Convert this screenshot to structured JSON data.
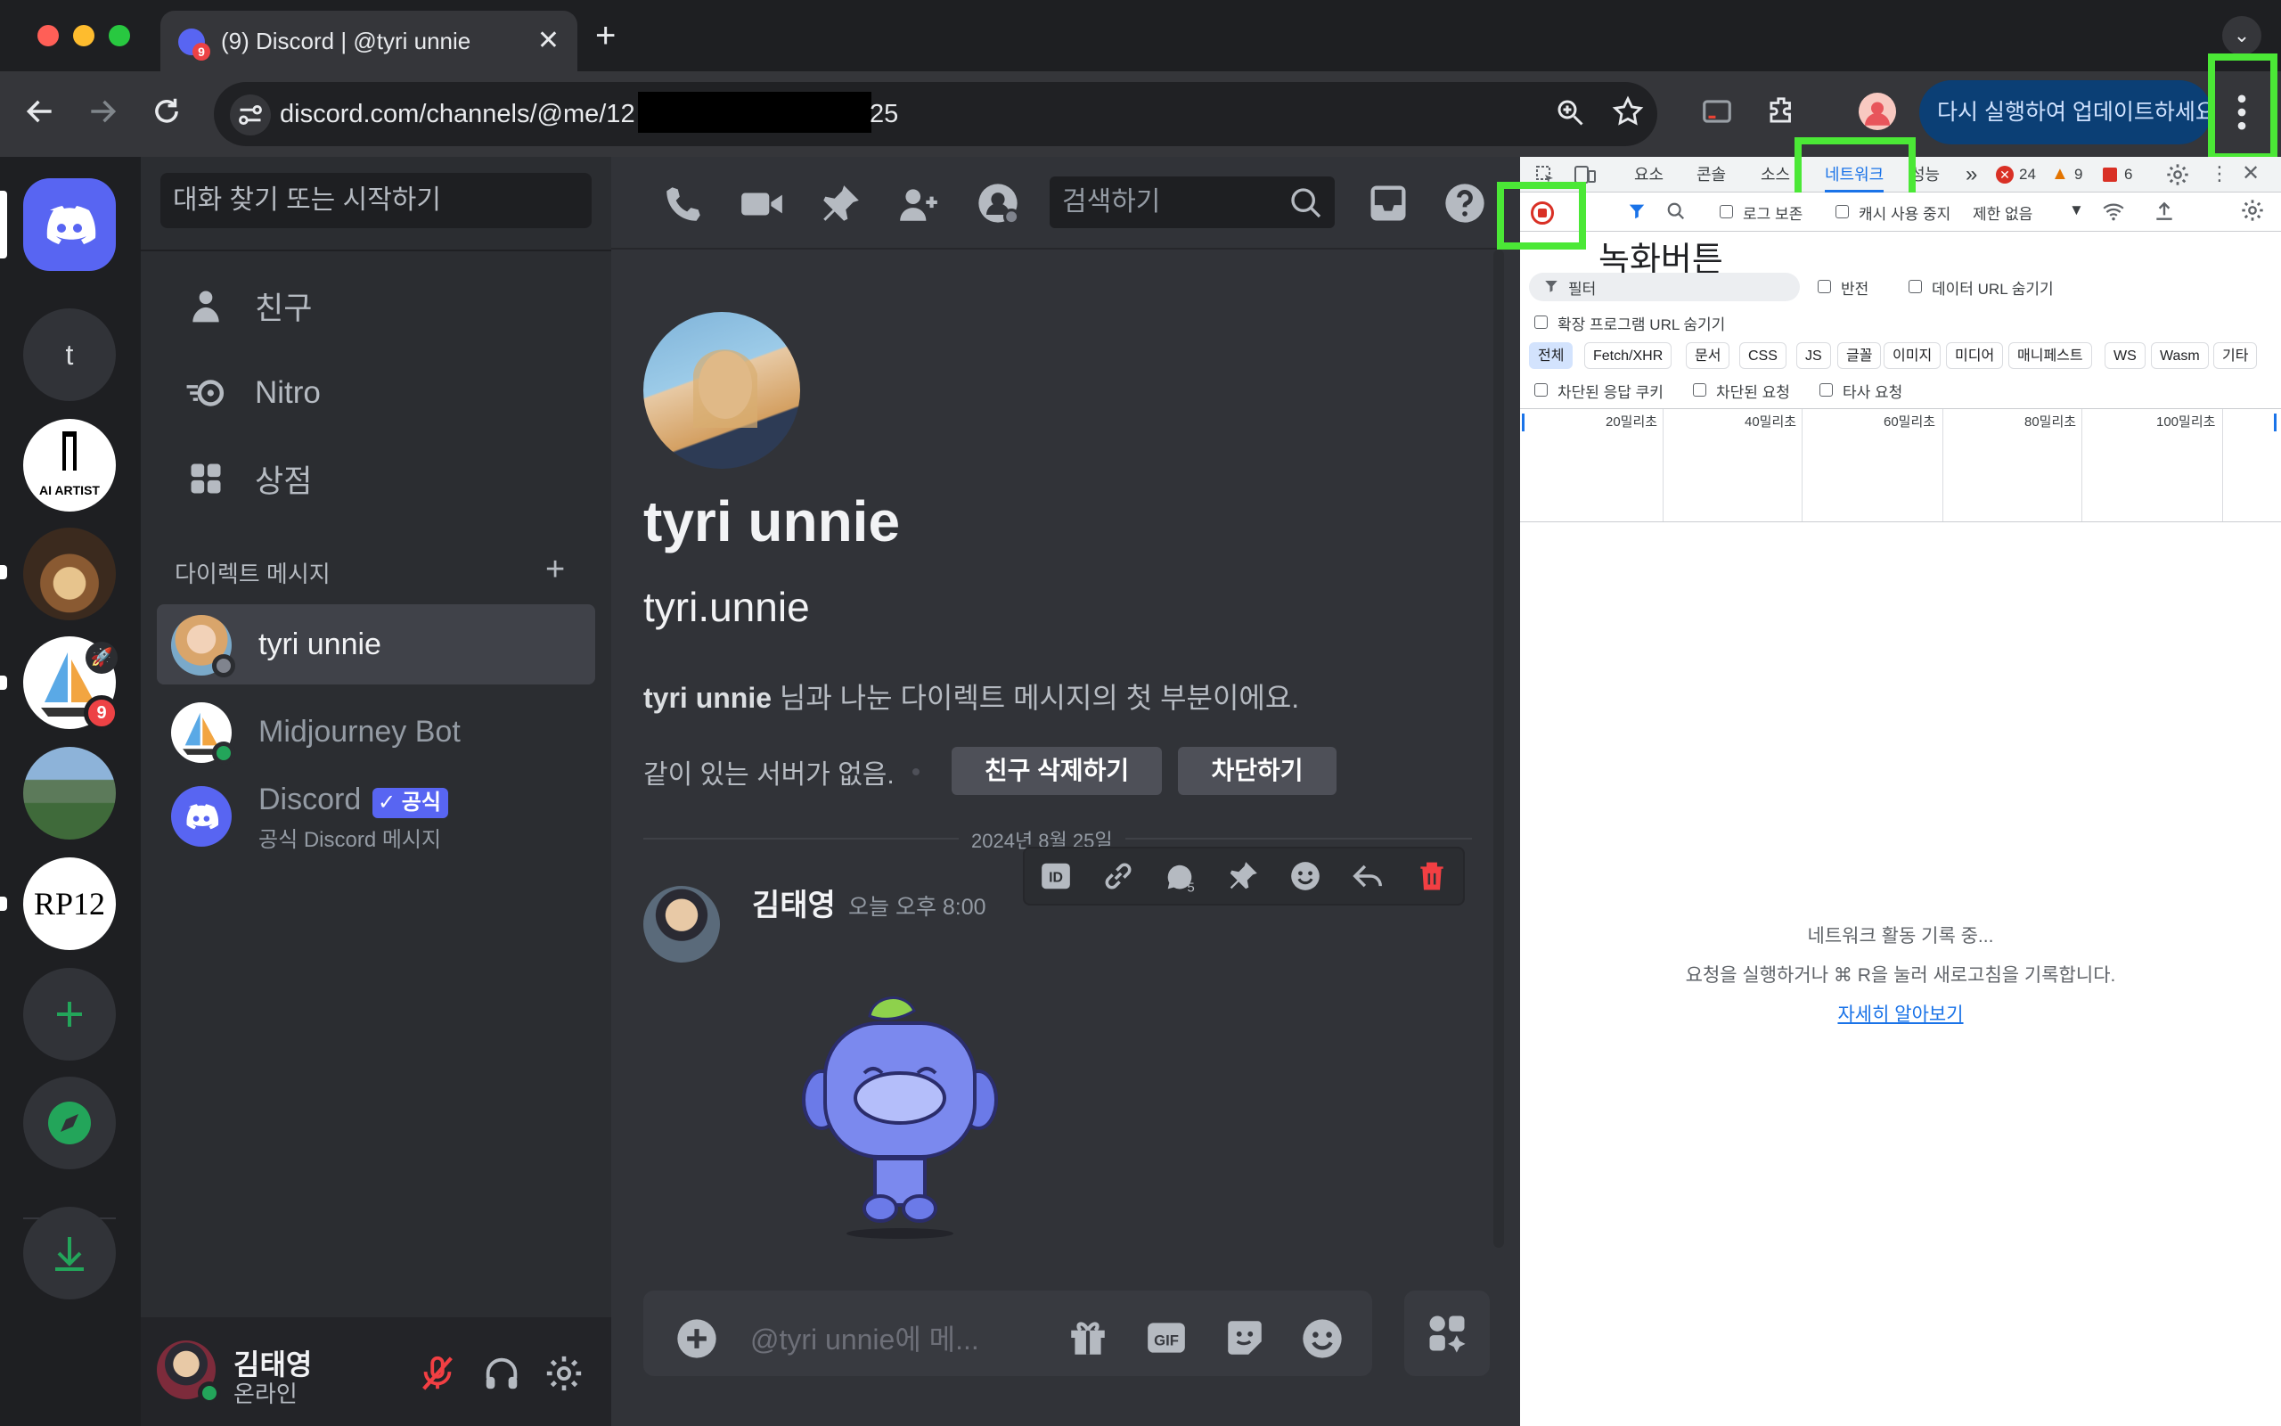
{
  "browser": {
    "tab_title": "(9) Discord | @tyri unnie",
    "tab_badge": "9",
    "url_prefix": "discord.com/channels/@me/12",
    "url_suffix": "25",
    "update_button": "다시 실행하여 업데이트하세요"
  },
  "guilds": [
    {
      "name": "home",
      "label": ""
    },
    {
      "name": "t",
      "label": "t"
    },
    {
      "name": "ai-artist",
      "label": "AI ARTIST"
    },
    {
      "name": "coffee",
      "label": ""
    },
    {
      "name": "midjourney",
      "label": "",
      "badge": "9"
    },
    {
      "name": "mountain",
      "label": ""
    },
    {
      "name": "rp12",
      "label": "RP12"
    }
  ],
  "dm_sidebar": {
    "search_placeholder": "대화 찾기 또는 시작하기",
    "nav": {
      "friends": "친구",
      "nitro": "Nitro",
      "shop": "상점"
    },
    "dm_header": "다이렉트 메시지",
    "dms": [
      {
        "name": "tyri unnie",
        "status": "offline",
        "subtitle": ""
      },
      {
        "name": "Midjourney Bot",
        "status": "online",
        "subtitle": ""
      },
      {
        "name": "Discord",
        "badge": "공식",
        "subtitle": "공식 Discord 메시지"
      }
    ]
  },
  "user_panel": {
    "name": "김태영",
    "status": "온라인"
  },
  "chat": {
    "search_placeholder": "검색하기",
    "display_name": "tyri unnie",
    "username": "tyri.unnie",
    "intro_bold": "tyri unnie",
    "intro_rest": " 님과 나눈 다이렉트 메시지의 첫 부분이에요.",
    "no_servers": "같이 있는 서버가 없음.",
    "remove_friend": "친구 삭제하기",
    "block": "차단하기",
    "date_divider": "2024년 8월 25일",
    "message": {
      "author": "김태영",
      "time": "오늘 오후 8:00"
    },
    "composer_placeholder": "@tyri unnie에 메..."
  },
  "devtools": {
    "tabs": [
      "요소",
      "콘솔",
      "소스",
      "네트워크",
      "성능"
    ],
    "active_tab": "네트워크",
    "errors": "24",
    "warnings": "9",
    "issues": "6",
    "preserve_log": "로그 보존",
    "disable_cache": "캐시 사용 중지",
    "throttle": "제한 없음",
    "record_annotation": "녹화버튼",
    "filter_placeholder": "필터",
    "invert": "반전",
    "hide_data_urls": "데이터 URL 숨기기",
    "hide_ext_urls": "확장 프로그램 URL 숨기기",
    "type_filters": [
      "전체",
      "Fetch/XHR",
      "문서",
      "CSS",
      "JS",
      "글꼴",
      "이미지",
      "미디어",
      "매니페스트",
      "WS",
      "Wasm",
      "기타"
    ],
    "blocked_cookies": "차단된 응답 쿠키",
    "blocked_requests": "차단된 요청",
    "third_party": "타사 요청",
    "timeline_labels": [
      "20밀리초",
      "40밀리초",
      "60밀리초",
      "80밀리초",
      "100밀리초"
    ],
    "recording_text": "네트워크 활동 기록 중...",
    "recording_hint": "요청을 실행하거나 ⌘ R을 눌러 새로고침을 기록합니다.",
    "learn_more": "자세히 알아보기"
  },
  "colors": {
    "blurple": "#5865f2",
    "green": "#23a55a",
    "highlight": "#4be836",
    "red": "#ed4245"
  }
}
